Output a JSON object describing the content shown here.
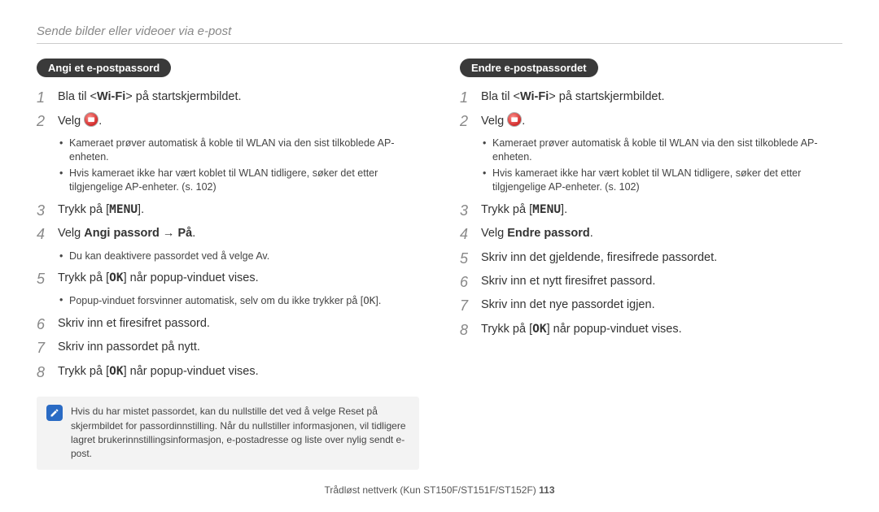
{
  "header": "Sende bilder eller videoer via e-post",
  "left": {
    "pill": "Angi et e-postpassord",
    "step1_pre": "Bla til <",
    "step1_bold": "Wi-Fi",
    "step1_post": "> på startskjermbildet.",
    "step2": "Velg ",
    "step2_after": ".",
    "sub_a": "Kameraet prøver automatisk å koble til WLAN via den sist tilkoblede AP-enheten.",
    "sub_b": "Hvis kameraet ikke har vært koblet til WLAN tidligere, søker det etter tilgjengelige AP-enheter. (s. 102)",
    "step3_pre": "Trykk på [",
    "step3_key": "MENU",
    "step3_post": "].",
    "step4_pre": "Velg ",
    "step4_bold": "Angi passord → På",
    "step4_post": ".",
    "step4_sub_pre": "Du kan deaktivere passordet ved å velge ",
    "step4_sub_bold": "Av",
    "step4_sub_post": ".",
    "step5_pre": "Trykk på [",
    "step5_key": "OK",
    "step5_post": "] når popup-vinduet vises.",
    "step5_sub_pre": "Popup-vinduet forsvinner automatisk, selv om du ikke trykker på [",
    "step5_sub_key": "OK",
    "step5_sub_post": "].",
    "step6": "Skriv inn et firesifret passord.",
    "step7": "Skriv inn passordet på nytt.",
    "step8_pre": "Trykk på [",
    "step8_key": "OK",
    "step8_post": "] når popup-vinduet vises.",
    "note_pre": "Hvis du har mistet passordet, kan du nullstille det ved å velge ",
    "note_bold": "Reset",
    "note_post": " på skjermbildet for passordinnstilling. Når du nullstiller informasjonen, vil tidligere lagret brukerinnstillingsinformasjon, e-postadresse og liste over nylig sendt e-post."
  },
  "right": {
    "pill": "Endre e-postpassordet",
    "step1_pre": "Bla til <",
    "step1_bold": "Wi-Fi",
    "step1_post": "> på startskjermbildet.",
    "step2": "Velg ",
    "step2_after": ".",
    "sub_a": "Kameraet prøver automatisk å koble til WLAN via den sist tilkoblede AP-enheten.",
    "sub_b": "Hvis kameraet ikke har vært koblet til WLAN tidligere, søker det etter tilgjengelige AP-enheter. (s. 102)",
    "step3_pre": "Trykk på [",
    "step3_key": "MENU",
    "step3_post": "].",
    "step4_pre": "Velg ",
    "step4_bold": "Endre passord",
    "step4_post": ".",
    "step5": "Skriv inn det gjeldende, firesifrede passordet.",
    "step6": "Skriv inn et nytt firesifret passord.",
    "step7": "Skriv inn det nye passordet igjen.",
    "step8_pre": "Trykk på [",
    "step8_key": "OK",
    "step8_post": "] når popup-vinduet vises."
  },
  "footer_text": "Trådløst nettverk (Kun ST150F/ST151F/ST152F)  ",
  "page_number": "113"
}
